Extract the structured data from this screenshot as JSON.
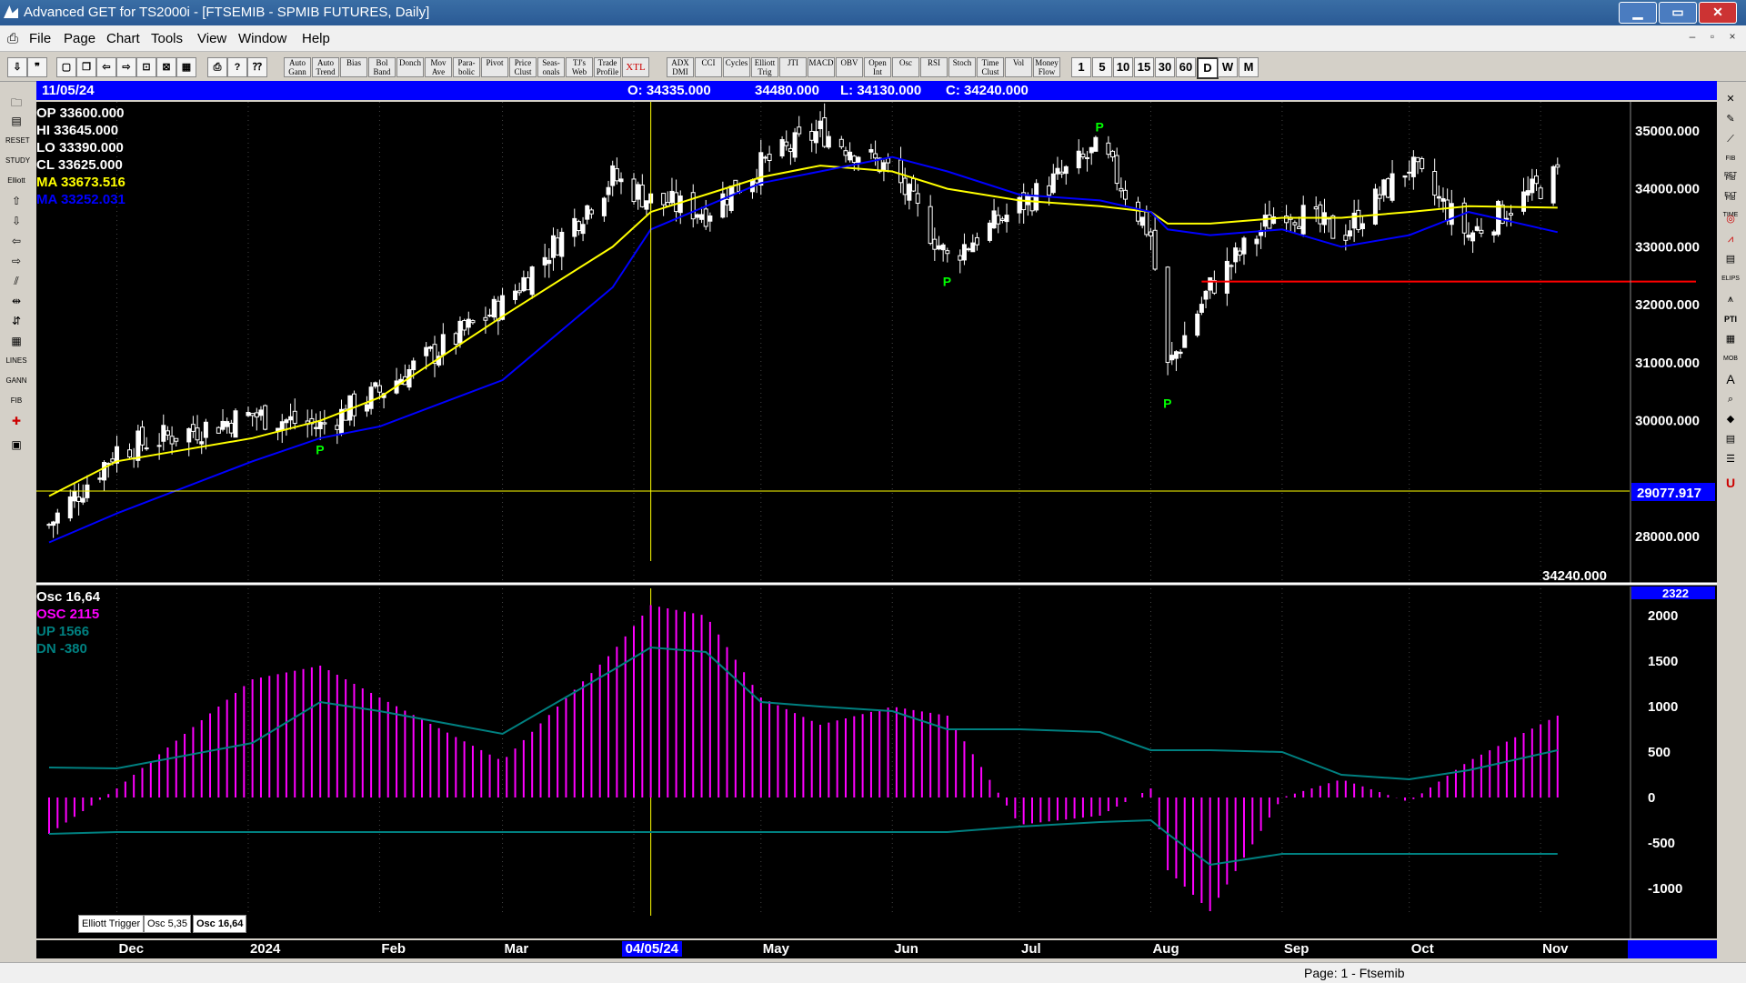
{
  "window": {
    "title": "Advanced GET for TS2000i - [FTSEMIB - SPMIB FUTURES, Daily]"
  },
  "menu": [
    "File",
    "Page",
    "Chart",
    "Tools",
    "View",
    "Window",
    "Help"
  ],
  "toolbar_studies": [
    "Auto Gann",
    "Auto Trend",
    "Bias",
    "Bol Band",
    "Donch",
    "Mov Ave",
    "Para-bolic",
    "Pivot",
    "Price Clust",
    "Seas-onals",
    "TJ's Web",
    "Trade Profile",
    "XTL",
    "ADX DMI",
    "CCI",
    "Cycles",
    "Elliott Trig",
    "JTI",
    "MACD",
    "OBV",
    "Open Int",
    "Osc",
    "RSI",
    "Stoch",
    "Time Clust",
    "Vol",
    "Money Flow"
  ],
  "toolbar_intervals": [
    "1",
    "5",
    "10",
    "15",
    "30",
    "60",
    "D",
    "W",
    "M"
  ],
  "ohlc": {
    "date": "11/05/24",
    "open": "O: 34335.000",
    "high": "34480.000",
    "low": "L: 34130.000",
    "close": "C: 34240.000"
  },
  "price_legend": {
    "op": "OP 33600.000",
    "hi": "HI  33645.000",
    "lo": "LO  33390.000",
    "cl": "CL  33625.000",
    "ma1": "MA  33673.516",
    "ma2": "MA  33252.031"
  },
  "price_axis": {
    "labels": [
      "35000.000",
      "34000.000",
      "33000.000",
      "32000.000",
      "31000.000",
      "30000.000",
      "28000.000"
    ],
    "crosshair": "29077.917",
    "last": "34240.000"
  },
  "osc_legend": {
    "name": "Osc 16,64",
    "osc": "OSC 2115",
    "up": "UP    1566",
    "dn": "DN   -380"
  },
  "osc_axis": {
    "labels": [
      "2000",
      "1500",
      "1000",
      "500",
      "0",
      "-500",
      "-1000"
    ],
    "top": "2322"
  },
  "time_axis": {
    "labels": [
      "Dec",
      "2024",
      "Feb",
      "Mar",
      "04/05/24",
      "May",
      "Jun",
      "Jul",
      "Aug",
      "Sep",
      "Oct",
      "Nov"
    ]
  },
  "tabs": [
    "Elliott Trigger",
    "Osc 5,35",
    "Osc 16,64"
  ],
  "status": {
    "page": "Page: 1 - Ftsemib"
  },
  "colors": {
    "bg": "#000000",
    "ma_fast": "#ffff00",
    "ma_slow": "#0000ff",
    "osc": "#ff00ff",
    "bands": "#008080",
    "pivot": "#00ff00",
    "support": "#ff0000"
  },
  "chart_data": {
    "type": "bar",
    "x": [
      "2023-11-15",
      "2023-12-01",
      "2024-01-02",
      "2024-01-18",
      "2024-02-01",
      "2024-03-01",
      "2024-03-27",
      "2024-04-05",
      "2024-04-18",
      "2024-05-01",
      "2024-05-15",
      "2024-06-01",
      "2024-06-14",
      "2024-07-01",
      "2024-07-20",
      "2024-08-01",
      "2024-08-05",
      "2024-08-15",
      "2024-09-01",
      "2024-09-15",
      "2024-10-01",
      "2024-10-15",
      "2024-11-05"
    ],
    "close": [
      28200,
      29500,
      30100,
      29900,
      30500,
      32000,
      34200,
      33800,
      33600,
      34400,
      35000,
      34300,
      32800,
      33700,
      34700,
      33200,
      30900,
      32300,
      33700,
      33200,
      34400,
      33200,
      34240
    ],
    "ma_fast": [
      28700,
      29300,
      29700,
      30000,
      30400,
      31800,
      33000,
      33600,
      33900,
      34200,
      34400,
      34300,
      34000,
      33800,
      33700,
      33600,
      33400,
      33400,
      33500,
      33500,
      33600,
      33700,
      33673.516
    ],
    "ma_slow": [
      27900,
      28400,
      29300,
      29700,
      29900,
      30700,
      32300,
      33300,
      33700,
      34100,
      34300,
      34550,
      34300,
      33900,
      33800,
      33600,
      33300,
      33200,
      33300,
      33000,
      33200,
      33600,
      33252.031
    ],
    "pivots": [
      {
        "x": "2024-01-18",
        "y": 29800
      },
      {
        "x": "2024-06-14",
        "y": 32700
      },
      {
        "x": "2024-07-20",
        "y": 34900
      },
      {
        "x": "2024-08-05",
        "y": 30600
      }
    ],
    "support": 32400,
    "osc": [
      -400,
      100,
      1300,
      1450,
      1100,
      400,
      1600,
      2115,
      2000,
      1100,
      800,
      1000,
      900,
      -300,
      -200,
      100,
      -800,
      -1250,
      0,
      200,
      -50,
      400,
      900
    ],
    "osc_up": [
      330,
      320,
      600,
      1050,
      950,
      700,
      1400,
      1650,
      1600,
      1050,
      1000,
      950,
      750,
      750,
      720,
      520,
      520,
      520,
      500,
      250,
      200,
      300,
      520
    ],
    "osc_dn": [
      -400,
      -380,
      -380,
      -380,
      -380,
      -380,
      -380,
      -380,
      -380,
      -380,
      -380,
      -380,
      -380,
      -320,
      -270,
      -250,
      -400,
      -740,
      -620,
      -620,
      -620,
      -620,
      -620
    ],
    "ylim": [
      27500,
      35500
    ],
    "osc_ylim": [
      -1300,
      2300
    ]
  }
}
